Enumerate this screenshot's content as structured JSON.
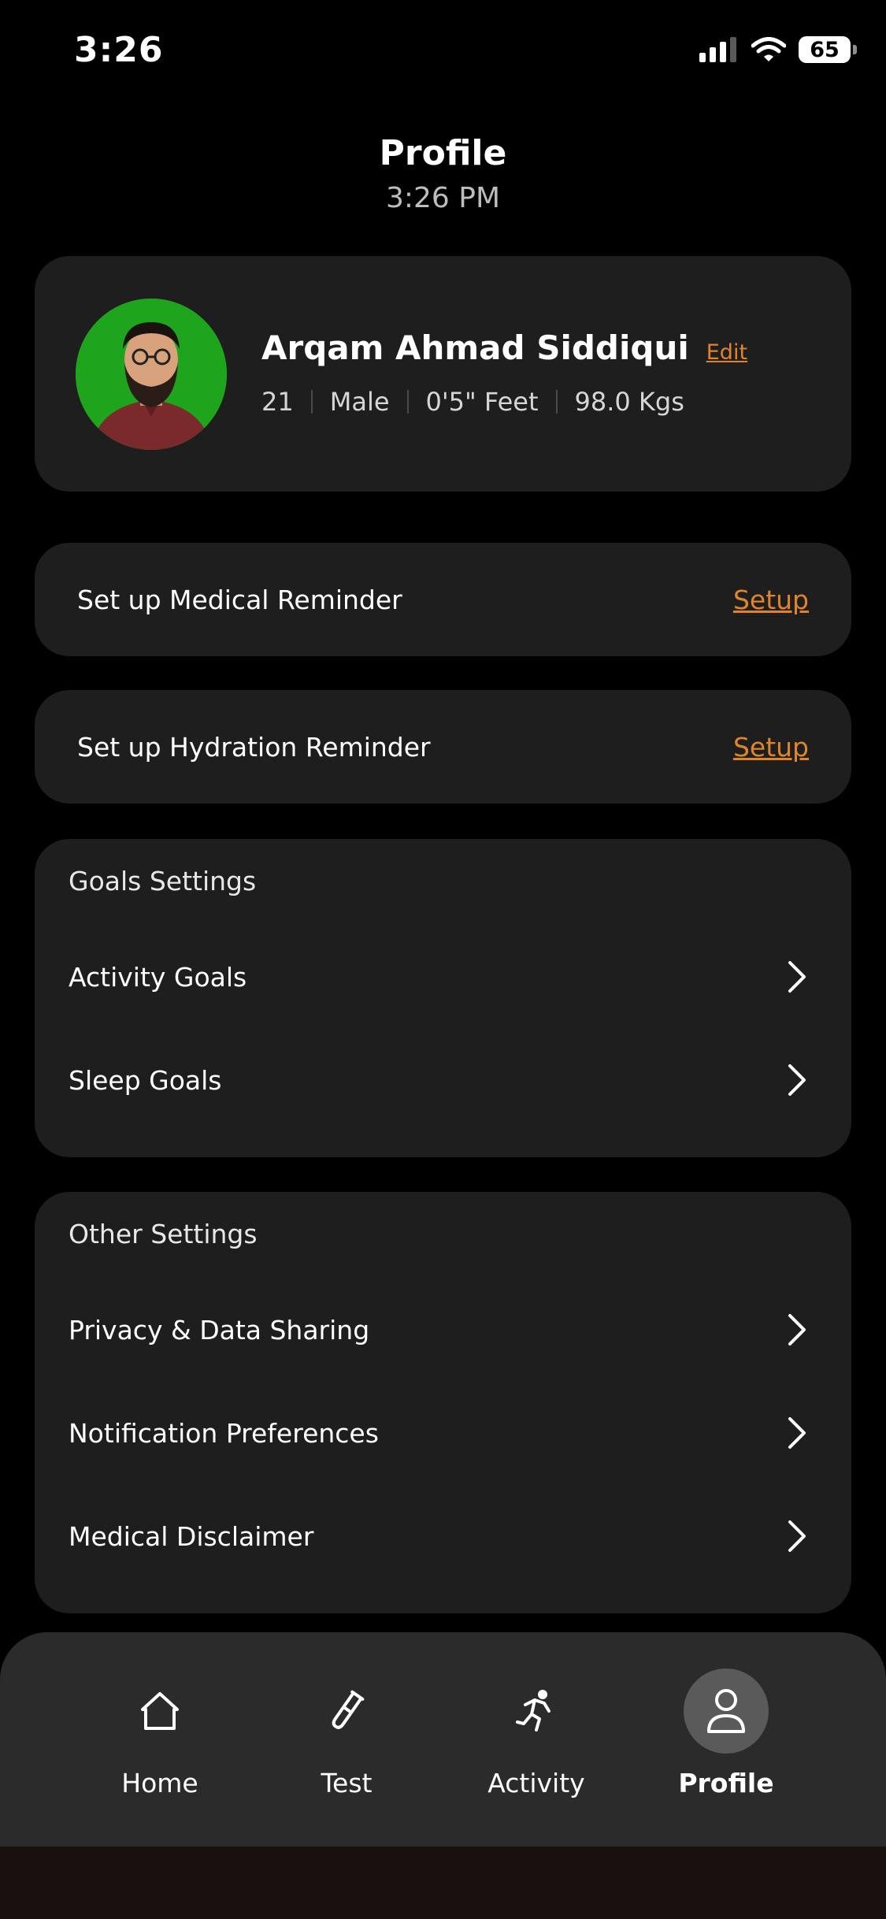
{
  "status_bar": {
    "time": "3:26",
    "battery": "65",
    "icons": [
      "cellular-signal-icon",
      "wifi-icon",
      "battery-icon"
    ]
  },
  "header": {
    "title": "Profile",
    "subtitle": "3:26 PM"
  },
  "profile": {
    "name": "Arqam Ahmad Siddiqui",
    "edit_label": "Edit",
    "age": "21",
    "gender": "Male",
    "height": "0'5\" Feet",
    "weight": "98.0 Kgs"
  },
  "reminders": [
    {
      "label": "Set up Medical Reminder",
      "action": "Setup"
    },
    {
      "label": "Set up Hydration Reminder",
      "action": "Setup"
    }
  ],
  "goals_settings": {
    "heading": "Goals Settings",
    "items": [
      {
        "label": "Activity Goals"
      },
      {
        "label": "Sleep Goals"
      }
    ]
  },
  "other_settings": {
    "heading": "Other Settings",
    "items": [
      {
        "label": "Privacy & Data Sharing"
      },
      {
        "label": "Notification Preferences"
      },
      {
        "label": "Medical Disclaimer"
      }
    ]
  },
  "tab_bar": {
    "tabs": [
      {
        "label": "Home",
        "icon": "home-icon",
        "active": false
      },
      {
        "label": "Test",
        "icon": "test-tube-icon",
        "active": false
      },
      {
        "label": "Activity",
        "icon": "running-person-icon",
        "active": false
      },
      {
        "label": "Profile",
        "icon": "user-icon",
        "active": true
      }
    ]
  },
  "colors": {
    "background": "#000000",
    "card": "#1e1e1e",
    "accent": "#e0842c",
    "tab_bar": "#2b2b2b",
    "avatar_background": "#1ea51d"
  }
}
